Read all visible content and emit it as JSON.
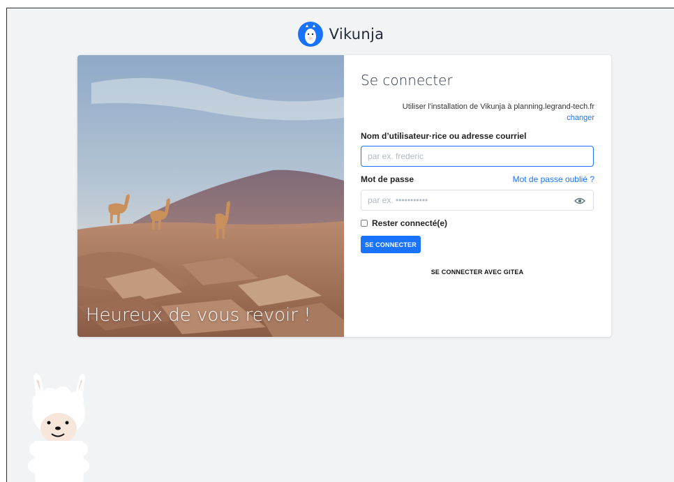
{
  "app": {
    "name": "Vikunja"
  },
  "hero": {
    "caption": "Heureux de vous revoir !"
  },
  "login": {
    "title": "Se connecter",
    "install_note": "Utiliser l'installation de Vikunja à planning.legrand-tech.fr",
    "change_link": "changer",
    "username_label": "Nom d’utilisateur·rice ou adresse courriel",
    "username_placeholder": "par ex. frederic",
    "password_label": "Mot de passe",
    "forgot_link": "Mot de passe oublié ?",
    "password_placeholder": "par ex. •••••••••••",
    "remember_label": "Rester connecté(e)",
    "submit_label": "SE CONNECTER",
    "gitea_label": "SE CONNECTER AVEC GITEA"
  },
  "colors": {
    "primary": "#1973ff",
    "background": "#f2f3f5"
  },
  "icons": [
    "vikunja-logo-icon",
    "eye-icon",
    "llama-mascot"
  ]
}
